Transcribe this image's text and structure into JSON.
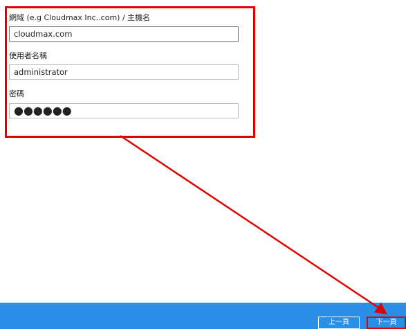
{
  "form": {
    "domain_label": "網域 (e.g Cloudmax Inc..com) / 主機名",
    "domain_value": "cloudmax.com",
    "username_label": "使用者名稱",
    "username_value": "administrator",
    "password_label": "密碼",
    "password_value": "●●●●●●"
  },
  "footer": {
    "prev_label": "上一頁",
    "next_label": "下一頁"
  },
  "colors": {
    "bar": "#2a8fe6",
    "highlight": "#e00000"
  }
}
